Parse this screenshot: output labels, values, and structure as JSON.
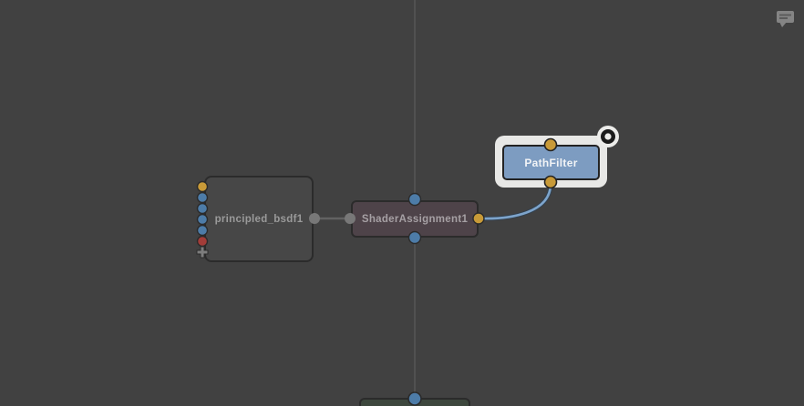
{
  "editor": {
    "kind": "node-graph-editor",
    "annotation_indicator": "speech-bubble-icon"
  },
  "colors": {
    "bg": "#414141",
    "wire-gray": "#515151",
    "wire-gray-strong": "#626262",
    "wire-blue": "#7da4cb",
    "wire-blue-edge": "#31404f",
    "node-gray": "#474747",
    "node-border": "#2b2b2b",
    "node-purple": "#4e4349",
    "node-blue": "#7d9cc1",
    "node-blue-border": "#232323",
    "node-green": "#3d473d",
    "halo": "#e8e8e6",
    "label-gray": "#9a9a9a",
    "label-purple": "#a6a0a4",
    "label-white": "#f2f4f6",
    "port-gold": "#c89a38",
    "port-blue": "#4d7ca8",
    "port-red": "#a23c38",
    "port-gray": "#787878",
    "port-stroke": "#2b2b2b",
    "plus-gray": "#7d7d7d",
    "focus-white": "#ececea",
    "focus-black": "#1b1b1b",
    "annotation-icon": "#8c8c8c",
    "annotation-lines": "#5e5e5e"
  },
  "nodes": {
    "principled_bsdf1": {
      "label": "principled_bsdf1",
      "input_ports": [
        "gold",
        "blue",
        "blue",
        "blue",
        "blue",
        "red"
      ],
      "add_port": "plus",
      "output_port": "gray"
    },
    "shader_assignment": {
      "label": "ShaderAssignment1",
      "ports": {
        "top": "blue",
        "bottom": "blue",
        "left": "gray",
        "right": "gold"
      }
    },
    "path_filter": {
      "label": "PathFilter",
      "selected": true,
      "focused": true,
      "ports": {
        "top": "gold",
        "bottom": "gold"
      }
    },
    "bottom_partial": {
      "label": "",
      "ports": {
        "top": "blue"
      }
    }
  },
  "connections": [
    {
      "from": "principled_bsdf1.output",
      "to": "ShaderAssignment1.shader",
      "style": "gray"
    },
    {
      "from": "vertical-wire-above",
      "to": "ShaderAssignment1.in",
      "style": "gray"
    },
    {
      "from": "ShaderAssignment1.out",
      "to": "bottom_partial.in",
      "style": "gray"
    },
    {
      "from": "PathFilter.out",
      "to": "ShaderAssignment1.filter",
      "style": "blue"
    }
  ]
}
